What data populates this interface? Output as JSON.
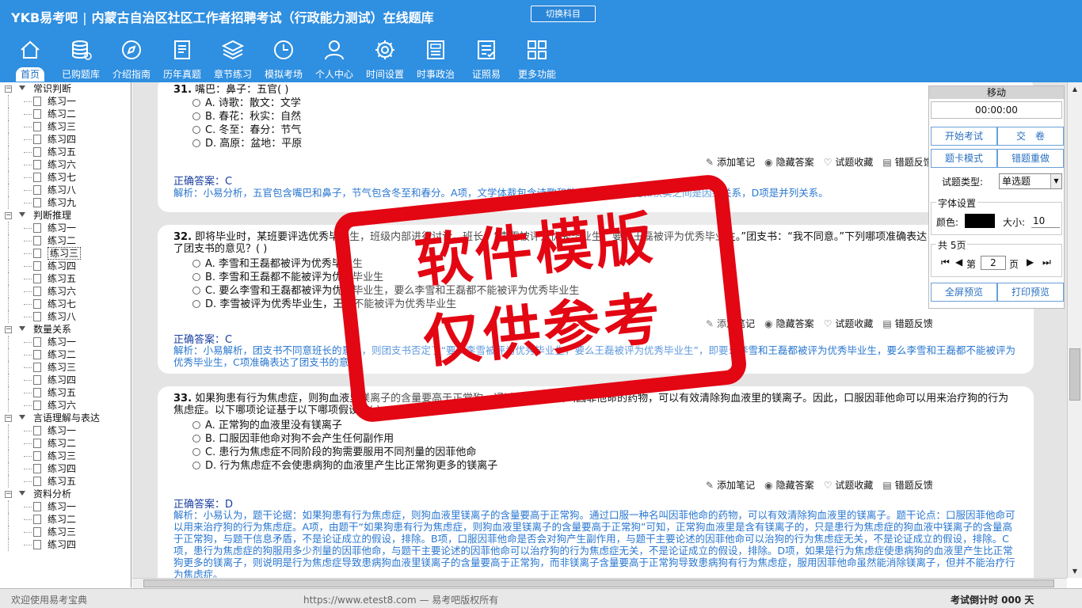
{
  "header": {
    "logo": "YKB易考吧",
    "title": "内蒙古自治区社区工作者招聘考试（行政能力测试）在线题库",
    "switch_label": "切换科目"
  },
  "nav": [
    {
      "label": "首页",
      "icon": "home-icon"
    },
    {
      "label": "已购题库",
      "icon": "database-icon"
    },
    {
      "label": "介绍指南",
      "icon": "compass-icon"
    },
    {
      "label": "历年真题",
      "icon": "document-icon"
    },
    {
      "label": "章节练习",
      "icon": "layers-icon"
    },
    {
      "label": "模拟考场",
      "icon": "clock-icon"
    },
    {
      "label": "个人中心",
      "icon": "user-icon"
    },
    {
      "label": "时间设置",
      "icon": "gear-icon"
    },
    {
      "label": "时事政治",
      "icon": "newspaper-icon"
    },
    {
      "label": "证照易",
      "icon": "checklist-icon"
    },
    {
      "label": "更多功能",
      "icon": "grid-icon"
    }
  ],
  "tree": [
    {
      "name": "常识判断",
      "items": [
        "练习一",
        "练习二",
        "练习三",
        "练习四",
        "练习五",
        "练习六",
        "练习七",
        "练习八",
        "练习九"
      ]
    },
    {
      "name": "判断推理",
      "items": [
        "练习一",
        "练习二",
        "练习三",
        "练习四",
        "练习五",
        "练习六",
        "练习七",
        "练习八"
      ]
    },
    {
      "name": "数量关系",
      "items": [
        "练习一",
        "练习二",
        "练习三",
        "练习四",
        "练习五",
        "练习六"
      ]
    },
    {
      "name": "言语理解与表达",
      "items": [
        "练习一",
        "练习二",
        "练习三",
        "练习四",
        "练习五"
      ]
    },
    {
      "name": "资料分析",
      "items": [
        "练习一",
        "练习二",
        "练习三",
        "练习四"
      ]
    }
  ],
  "questions": [
    {
      "num": "31.",
      "text": "嘴巴：鼻子：五官( )",
      "options": [
        "A. 诗歌：散文：文学",
        "B. 春花：秋实：自然",
        "C. 冬至：春分：节气",
        "D. 高原：盆地：平原"
      ],
      "answer_label": "正确答案：",
      "answer": "C",
      "explanation": "解析：小易分析，五官包含嘴巴和鼻子，节气包含冬至和春分。A项，文学体裁包含诗歌和散文，B项，春花和秋实之间是因果关系，D项是并列关系。"
    },
    {
      "num": "32.",
      "text": "即将毕业时，某班要评选优秀毕业生，班级内部进行讨论。班长：“李雪被评为优秀毕业生，要么王磊被评为优秀毕业生。”团支书：“我不同意。”下列哪项准确表达了团支书的意见？( )",
      "options": [
        "A. 李雪和王磊都被评为优秀毕业生",
        "B. 李雪和王磊都不能被评为优秀毕业生",
        "C. 要么李雪和王磊都被评为优秀毕业生，要么李雪和王磊都不能被评为优秀毕业生",
        "D. 李雪被评为优秀毕业生，王磊不能被评为优秀毕业生"
      ],
      "answer_label": "正确答案：",
      "answer": "C",
      "explanation": "解析：小易解析，团支书不同意班长的意见，则团支书否定了“要么李雪被评为优秀毕业生，要么王磊被评为优秀毕业生”，即要么李雪和王磊都被评为优秀毕业生，要么李雪和王磊都不能被评为优秀毕业生，C项准确表达了团支书的意见。"
    },
    {
      "num": "33.",
      "text": "如果狗患有行为焦虑症，则狗血液里镁离子的含量要高于正常狗。通过口服一种名叫因菲他命的药物，可以有效清除狗血液里的镁离子。因此，口服因菲他命可以用来治疗狗的行为焦虑症。以下哪项论证基于以下哪项假设？( )",
      "options": [
        "A. 正常狗的血液里没有镁离子",
        "B. 口服因菲他命对狗不会产生任何副作用",
        "C. 患行为焦虑症不同阶段的狗需要服用不同剂量的因菲他命",
        "D. 行为焦虑症不会使患病狗的血液里产生比正常狗更多的镁离子"
      ],
      "answer_label": "正确答案：",
      "answer": "D",
      "explanation": "解析：小易认为，题干论据：如果狗患有行为焦虑症，则狗血液里镁离子的含量要高于正常狗。通过口服一种名叫因菲他命的药物，可以有效清除狗血液里的镁离子。题干论点：口服因菲他命可以用来治疗狗的行为焦虑症。A项，由题干“如果狗患有行为焦虑症，则狗血液里镁离子的含量要高于正常狗”可知，正常狗血液里是含有镁离子的，只是患行为焦虑症的狗血液中镁离子的含量高于正常狗，与题干信息矛盾，不是论证成立的假设，排除。B项，口服因菲他命是否会对狗产生副作用，与题干主要论述的因菲他命可以治狗的行为焦虑症无关，不是论证成立的假设，排除。C项，患行为焦虑症的狗服用多少剂量的因菲他命，与题干主要论述的因菲他命可以治疗狗的行为焦虑症无关，不是论证成立的假设，排除。D项，如果是行为焦虑症使患病狗的血液里产生比正常狗更多的镁离子，则说明是行为焦虑症导致患病狗血液里镁离子的含量要高于正常狗，而非镁离子含量要高于正常狗导致患病狗有行为焦虑症，服用因菲他命虽然能消除镁离子，但并不能治疗行为焦虑症。"
    }
  ],
  "actions": {
    "note": "添加笔记",
    "hide": "隐藏答案",
    "fav": "试题收藏",
    "report": "错题反馈"
  },
  "panel": {
    "title": "移动",
    "timer": "00:00:00",
    "start": "开始考试",
    "submit": "交　卷",
    "card_mode": "题卡模式",
    "redo": "错题重做",
    "type_label": "试题类型:",
    "type_value": "单选题",
    "font_legend": "字体设置",
    "color_label": "颜色:",
    "size_label": "大小:",
    "size_value": "10",
    "pages_legend": "共 5页",
    "page_prefix": "第",
    "page_value": "2",
    "page_suffix": "页",
    "fullscreen": "全屏预览",
    "print": "打印预览"
  },
  "status": {
    "left": "欢迎使用易考宝典",
    "mid": "https://www.etest8.com — 易考吧版权所有",
    "right": "考试倒计时 000 天"
  },
  "watermark": {
    "line1": "软件模版",
    "line2": "仅供参考"
  },
  "colors": {
    "topbar": "#2f8fe0",
    "answer": "#1a3fa0",
    "explanation": "#2a77d0",
    "watermark": "#e30613"
  }
}
